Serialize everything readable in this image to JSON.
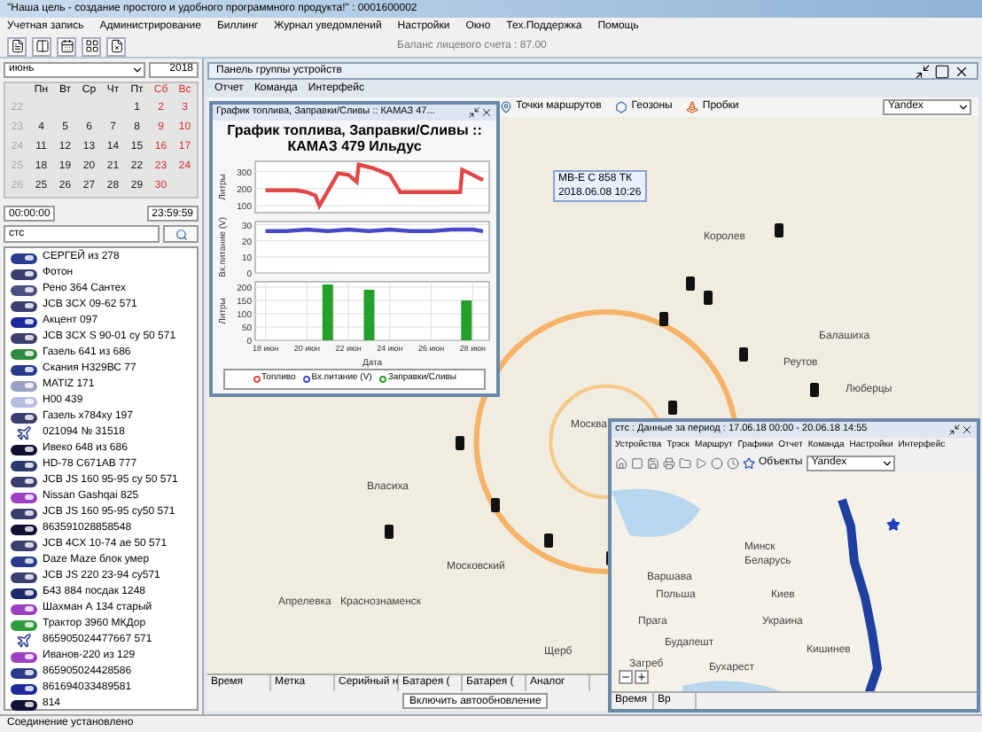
{
  "window": {
    "title": "\"Наша цель - создание простого и удобного программного продукта!\" : 0001600002"
  },
  "menu": [
    "Учетная запись",
    "Администрирование",
    "Биллинг",
    "Журнал уведомлений",
    "Настройки",
    "Окно",
    "Тех.Поддержка",
    "Помощь"
  ],
  "toolbar": {
    "balance": "Баланс лицевого счета : 87.00"
  },
  "sidebar": {
    "month": "июнь",
    "year": "2018",
    "weekdays": [
      {
        "label": "Пн",
        "weekend": false
      },
      {
        "label": "Вт",
        "weekend": false
      },
      {
        "label": "Ср",
        "weekend": false
      },
      {
        "label": "Чт",
        "weekend": false
      },
      {
        "label": "Пт",
        "weekend": false
      },
      {
        "label": "Сб",
        "weekend": true
      },
      {
        "label": "Вс",
        "weekend": true
      }
    ],
    "weeks": [
      {
        "number": "22",
        "days": [
          {
            "day": "1",
            "weekend": false
          },
          {
            "day": "2",
            "weekend": true
          },
          {
            "day": "3",
            "weekend": true
          }
        ]
      },
      {
        "number": "23",
        "days": [
          {
            "day": "4",
            "weekend": false
          },
          {
            "day": "5",
            "weekend": false
          },
          {
            "day": "6",
            "weekend": false
          },
          {
            "day": "7",
            "weekend": false
          },
          {
            "day": "8",
            "weekend": false
          },
          {
            "day": "9",
            "weekend": true
          },
          {
            "day": "10",
            "weekend": true
          }
        ]
      },
      {
        "number": "24",
        "days": [
          {
            "day": "11",
            "weekend": false
          },
          {
            "day": "12",
            "weekend": false
          },
          {
            "day": "13",
            "weekend": false
          },
          {
            "day": "14",
            "weekend": false
          },
          {
            "day": "15",
            "weekend": false
          },
          {
            "day": "16",
            "weekend": true
          },
          {
            "day": "17",
            "weekend": true
          }
        ]
      },
      {
        "number": "25",
        "days": [
          {
            "day": "18",
            "weekend": false
          },
          {
            "day": "19",
            "weekend": false
          },
          {
            "day": "20",
            "weekend": false
          },
          {
            "day": "21",
            "weekend": false
          },
          {
            "day": "22",
            "weekend": false
          },
          {
            "day": "23",
            "weekend": true
          },
          {
            "day": "24",
            "weekend": true
          }
        ]
      },
      {
        "number": "26",
        "days": [
          {
            "day": "25",
            "weekend": false
          },
          {
            "day": "26",
            "weekend": false
          },
          {
            "day": "27",
            "weekend": false
          },
          {
            "day": "28",
            "weekend": false
          },
          {
            "day": "29",
            "weekend": false
          },
          {
            "day": "30",
            "weekend": true
          }
        ]
      }
    ],
    "time_from": "00:00:00",
    "time_to": "23:59:59",
    "search": {
      "value": "стс"
    },
    "devices": [
      {
        "name": "СЕРГЕЙ из 278",
        "kind": "vehicle",
        "color": "#2a3a8c"
      },
      {
        "name": "Фотон",
        "kind": "vehicle",
        "color": "#3a3f6e"
      },
      {
        "name": "Рено 364 Сантех",
        "kind": "vehicle",
        "color": "#4a4f7e"
      },
      {
        "name": "JCB 3CX 09-62 571",
        "kind": "vehicle",
        "color": "#3a3f6e"
      },
      {
        "name": "Акцент 097",
        "kind": "vehicle",
        "color": "#1e2a9c"
      },
      {
        "name": "JCB 3CX S 90-01 су 50 571",
        "kind": "vehicle",
        "color": "#3a3f6e"
      },
      {
        "name": "Газель 641 из 686",
        "kind": "vehicle",
        "color": "#2e8b3e"
      },
      {
        "name": "Скания Н329ВС 77",
        "kind": "vehicle",
        "color": "#2a3a8c"
      },
      {
        "name": "MATIZ 171",
        "kind": "vehicle",
        "color": "#9aa0c0"
      },
      {
        "name": "Н00 439",
        "kind": "vehicle",
        "color": "#b8bce0"
      },
      {
        "name": "Газель х784ху 197",
        "kind": "vehicle",
        "color": "#3a3f6e"
      },
      {
        "name": "021094 № 31518",
        "kind": "plane",
        "color": "#2a3a8c"
      },
      {
        "name": "Ивеко 648 из 686",
        "kind": "vehicle",
        "color": "#111133"
      },
      {
        "name": "HD-78 С671АВ 777",
        "kind": "vehicle",
        "color": "#2a3a6c"
      },
      {
        "name": "JCB JS 160 95-95 су 50 571",
        "kind": "vehicle",
        "color": "#3a3f6e"
      },
      {
        "name": "Nissan Gashqai 825",
        "kind": "vehicle",
        "color": "#9a40c0"
      },
      {
        "name": "JCB JS 160 95-95 су50 571",
        "kind": "vehicle",
        "color": "#3a3f6e"
      },
      {
        "name": "863591028858548",
        "kind": "vehicle",
        "color": "#111133"
      },
      {
        "name": "JCB 4CX 10-74 ае 50 571",
        "kind": "vehicle",
        "color": "#3a3f6e"
      },
      {
        "name": "Daze Maze блок умер",
        "kind": "vehicle",
        "color": "#2a3a8c"
      },
      {
        "name": "JCB JS 220 23-94 су571",
        "kind": "vehicle",
        "color": "#3a3f6e"
      },
      {
        "name": "Б43 884 посдак 1248",
        "kind": "vehicle",
        "color": "#1e2a6c"
      },
      {
        "name": "Шахман А 134 старый",
        "kind": "vehicle",
        "color": "#9a40c0"
      },
      {
        "name": "Трактор 3960 МКДор",
        "kind": "vehicle",
        "color": "#2e9b3e"
      },
      {
        "name": "865905024477667 571",
        "kind": "plane",
        "color": "#2a3a8c"
      },
      {
        "name": "Иванов-220 из 129",
        "kind": "vehicle",
        "color": "#9a40c0"
      },
      {
        "name": "865905024428586",
        "kind": "vehicle",
        "color": "#2a3a8c"
      },
      {
        "name": "861694033489581",
        "kind": "vehicle",
        "color": "#1e2a9c"
      },
      {
        "name": "814",
        "kind": "vehicle",
        "color": "#111133"
      }
    ]
  },
  "main_panel": {
    "title": "Панель группы устройств",
    "menu": [
      "Отчет",
      "Команда",
      "Интерфейс"
    ],
    "map_toolbar": [
      "Точки маршрутов",
      "Геозоны",
      "Пробки"
    ],
    "map_source": "Yandex",
    "map_labels": [
      "Королев",
      "Балашиха",
      "Реутов",
      "Москва",
      "Люберцы",
      "Власиха",
      "Московский",
      "Апрелевка",
      "Краснознаменск",
      "Щерб"
    ],
    "tooltip": {
      "name": "МВ-Е С 858 ТК",
      "time": "2018.06.08 10:26"
    },
    "columns": [
      "Время",
      "Метка",
      "Серийный н",
      "Батарея (",
      "Батарея (",
      "Аналог"
    ],
    "autoupdate_button": "Включить автообновление"
  },
  "chart_window": {
    "title": "График топлива, Заправки/Сливы :: КАМАЗ 47...",
    "heading": "График топлива, Заправки/Сливы :: КАМАЗ 479 Ильдус",
    "plots": [
      {
        "chart_data": {
          "type": "line",
          "grid": true,
          "ylabel": "Литры",
          "xlim": [
            17.5,
            28.8
          ],
          "ylim": [
            60,
            360
          ],
          "yticks": [
            100,
            200,
            300
          ],
          "x": [
            18,
            19,
            19.5,
            20,
            20.4,
            20.6,
            21.5,
            22,
            22.4,
            22.5,
            23.2,
            23.6,
            24,
            24.5,
            25.5,
            26.5,
            27.4,
            27.5,
            28,
            28.5
          ],
          "series": [
            {
              "name": "Топливо",
              "color": "#e04848",
              "values": [
                190,
                190,
                190,
                180,
                160,
                100,
                290,
                280,
                240,
                340,
                320,
                300,
                280,
                180,
                180,
                180,
                180,
                310,
                280,
                250
              ]
            }
          ]
        }
      },
      {
        "chart_data": {
          "type": "line",
          "grid": true,
          "ylabel": "Вх.питание (V)",
          "xlim": [
            17.5,
            28.8
          ],
          "ylim": [
            0,
            32
          ],
          "yticks": [
            0,
            10,
            20,
            30
          ],
          "x": [
            18,
            19,
            20,
            21,
            22,
            23,
            24,
            25,
            26,
            27,
            28,
            28.5
          ],
          "series": [
            {
              "name": "Вх.питание (V)",
              "color": "#4848c8",
              "values": [
                26,
                26,
                27,
                26,
                27,
                26,
                27,
                26,
                26,
                27,
                27,
                26
              ]
            }
          ]
        }
      },
      {
        "chart_data": {
          "type": "bar",
          "grid": true,
          "xlabel": "Дата",
          "ylabel": "Литры",
          "xlim": [
            17.5,
            28.8
          ],
          "ylim": [
            0,
            220
          ],
          "yticks": [
            0,
            50,
            100,
            150,
            200
          ],
          "xticks": [
            {
              "value": 18,
              "label": "18 июн"
            },
            {
              "value": 20,
              "label": "20 июн"
            },
            {
              "value": 22,
              "label": "22 июн"
            },
            {
              "value": 24,
              "label": "24 июн"
            },
            {
              "value": 26,
              "label": "26 июн"
            },
            {
              "value": 28,
              "label": "28 июн"
            }
          ],
          "x": [
            21,
            23,
            27.7
          ],
          "series": [
            {
              "name": "Заправки/Сливы",
              "color": "#22a02a",
              "values": [
                210,
                190,
                150
              ]
            }
          ]
        }
      }
    ]
  },
  "history_window": {
    "title": "стс : Данные за период : 17.06.18 00:00 - 20.06.18 14:55",
    "menu": [
      "Устройства",
      "Трэск",
      "Маршрут",
      "Графики",
      "Отчет",
      "Команда",
      "Настройки",
      "Интерфейс"
    ],
    "objects_label": "Объекты",
    "map_source": "Yandex",
    "map_labels": [
      "Минск",
      "Беларусь",
      "Варшава",
      "Польша",
      "Прага",
      "Киев",
      "Украина",
      "Будапешт",
      "Загреб",
      "Кишинев",
      "Бухарест"
    ],
    "columns": [
      "Время",
      "Вр"
    ]
  },
  "status_bar": "Соединение установлено"
}
